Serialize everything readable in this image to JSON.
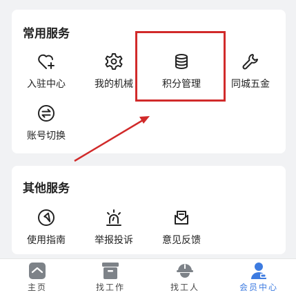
{
  "sections": [
    {
      "title": "常用服务",
      "items": [
        {
          "label": "入驻中心",
          "icon": "heart-plus-icon"
        },
        {
          "label": "我的机械",
          "icon": "gear-icon"
        },
        {
          "label": "积分管理",
          "icon": "database-icon"
        },
        {
          "label": "同城五金",
          "icon": "wrench-icon"
        },
        {
          "label": "账号切换",
          "icon": "switch-icon"
        }
      ]
    },
    {
      "title": "其他服务",
      "items": [
        {
          "label": "使用指南",
          "icon": "navigation-icon"
        },
        {
          "label": "举报投诉",
          "icon": "alarm-light-icon"
        },
        {
          "label": "意见反馈",
          "icon": "mail-feedback-icon"
        }
      ]
    }
  ],
  "tabbar": [
    {
      "label": "主页",
      "icon": "home-icon",
      "active": false
    },
    {
      "label": "找工作",
      "icon": "briefcase-icon",
      "active": false
    },
    {
      "label": "找工人",
      "icon": "worker-helmet-icon",
      "active": false
    },
    {
      "label": "会员中心",
      "icon": "member-icon",
      "active": true
    }
  ],
  "colors": {
    "accent": "#3d7be0",
    "annotation": "#d12a2a",
    "icon_gray": "#7d8288"
  }
}
